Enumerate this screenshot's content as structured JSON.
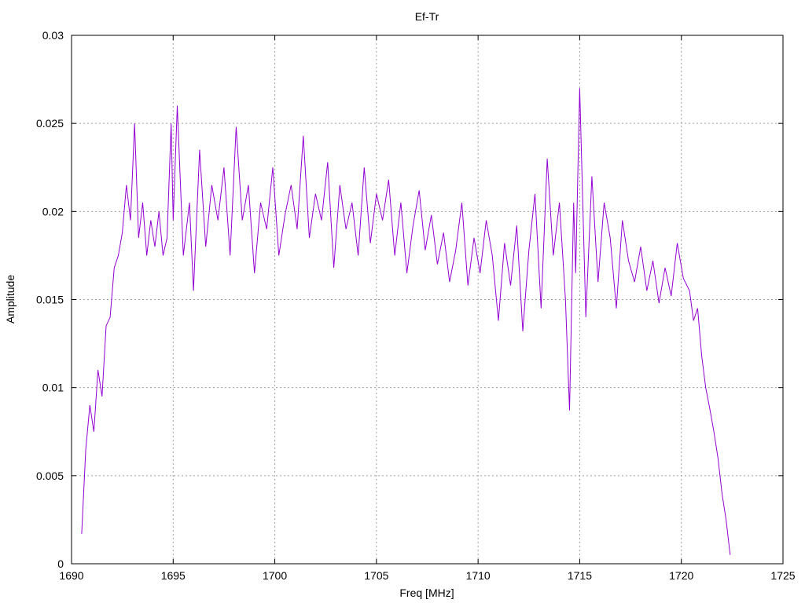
{
  "chart_data": {
    "type": "line",
    "title": "Ef-Tr",
    "xlabel": "Freq [MHz]",
    "ylabel": "Amplitude",
    "xlim": [
      1690,
      1725
    ],
    "ylim": [
      0,
      0.03
    ],
    "xticks": [
      1690,
      1695,
      1700,
      1705,
      1710,
      1715,
      1720,
      1725
    ],
    "xtick_labels": [
      "1690",
      "1695",
      "1700",
      "1705",
      "1710",
      "1715",
      "1720",
      "1725"
    ],
    "yticks": [
      0,
      0.005,
      0.01,
      0.015,
      0.02,
      0.025,
      0.03
    ],
    "ytick_labels": [
      "0",
      "0.005",
      "0.01",
      "0.015",
      "0.02",
      "0.025",
      "0.03"
    ],
    "grid": true,
    "legend": "none",
    "series": [
      {
        "color": "#9400d3",
        "x": [
          1690.5,
          1690.7,
          1690.9,
          1691.1,
          1691.3,
          1691.5,
          1691.7,
          1691.9,
          1692.1,
          1692.3,
          1692.5,
          1692.7,
          1692.9,
          1693.1,
          1693.3,
          1693.5,
          1693.7,
          1693.9,
          1694.1,
          1694.3,
          1694.5,
          1694.7,
          1694.9,
          1695.0,
          1695.2,
          1695.5,
          1695.8,
          1696.0,
          1696.3,
          1696.6,
          1696.9,
          1697.2,
          1697.5,
          1697.8,
          1698.1,
          1698.4,
          1698.7,
          1699.0,
          1699.3,
          1699.6,
          1699.9,
          1700.2,
          1700.5,
          1700.8,
          1701.1,
          1701.4,
          1701.7,
          1702.0,
          1702.3,
          1702.6,
          1702.9,
          1703.2,
          1703.5,
          1703.8,
          1704.1,
          1704.4,
          1704.7,
          1705.0,
          1705.3,
          1705.6,
          1705.9,
          1706.2,
          1706.5,
          1706.8,
          1707.1,
          1707.4,
          1707.7,
          1708.0,
          1708.3,
          1708.6,
          1708.9,
          1709.2,
          1709.5,
          1709.8,
          1710.1,
          1710.4,
          1710.7,
          1711.0,
          1711.3,
          1711.6,
          1711.9,
          1712.2,
          1712.5,
          1712.8,
          1713.1,
          1713.4,
          1713.7,
          1714.0,
          1714.3,
          1714.5,
          1714.7,
          1714.8,
          1715.0,
          1715.3,
          1715.6,
          1715.9,
          1716.2,
          1716.5,
          1716.8,
          1717.1,
          1717.4,
          1717.7,
          1718.0,
          1718.3,
          1718.6,
          1718.9,
          1719.2,
          1719.5,
          1719.8,
          1720.1,
          1720.4,
          1720.6,
          1720.8,
          1721.0,
          1721.2,
          1721.4,
          1721.6,
          1721.8,
          1722.0,
          1722.2,
          1722.4
        ],
        "y": [
          0.0017,
          0.0065,
          0.009,
          0.0075,
          0.011,
          0.0095,
          0.0135,
          0.014,
          0.0168,
          0.0175,
          0.0188,
          0.0215,
          0.0195,
          0.025,
          0.0185,
          0.0205,
          0.0175,
          0.0195,
          0.018,
          0.02,
          0.0175,
          0.0185,
          0.025,
          0.0195,
          0.026,
          0.0175,
          0.0205,
          0.0155,
          0.0235,
          0.018,
          0.0215,
          0.0195,
          0.0225,
          0.0175,
          0.0248,
          0.0195,
          0.0215,
          0.0165,
          0.0205,
          0.019,
          0.0225,
          0.0175,
          0.0198,
          0.0215,
          0.019,
          0.0243,
          0.0185,
          0.021,
          0.0195,
          0.0228,
          0.0168,
          0.0215,
          0.019,
          0.0205,
          0.0175,
          0.0225,
          0.0182,
          0.021,
          0.0195,
          0.0218,
          0.0175,
          0.0205,
          0.0165,
          0.0192,
          0.0212,
          0.0178,
          0.0198,
          0.017,
          0.0188,
          0.016,
          0.0178,
          0.0205,
          0.0158,
          0.0185,
          0.0165,
          0.0195,
          0.0175,
          0.0138,
          0.0182,
          0.0158,
          0.0192,
          0.0132,
          0.0178,
          0.021,
          0.0145,
          0.023,
          0.0175,
          0.0205,
          0.015,
          0.0087,
          0.0205,
          0.0165,
          0.027,
          0.014,
          0.022,
          0.016,
          0.0205,
          0.0185,
          0.0145,
          0.0195,
          0.0172,
          0.016,
          0.018,
          0.0155,
          0.0172,
          0.0148,
          0.0168,
          0.0152,
          0.0182,
          0.0162,
          0.0155,
          0.0138,
          0.0145,
          0.0118,
          0.01,
          0.0088,
          0.0075,
          0.006,
          0.004,
          0.0025,
          0.0005
        ]
      }
    ]
  }
}
